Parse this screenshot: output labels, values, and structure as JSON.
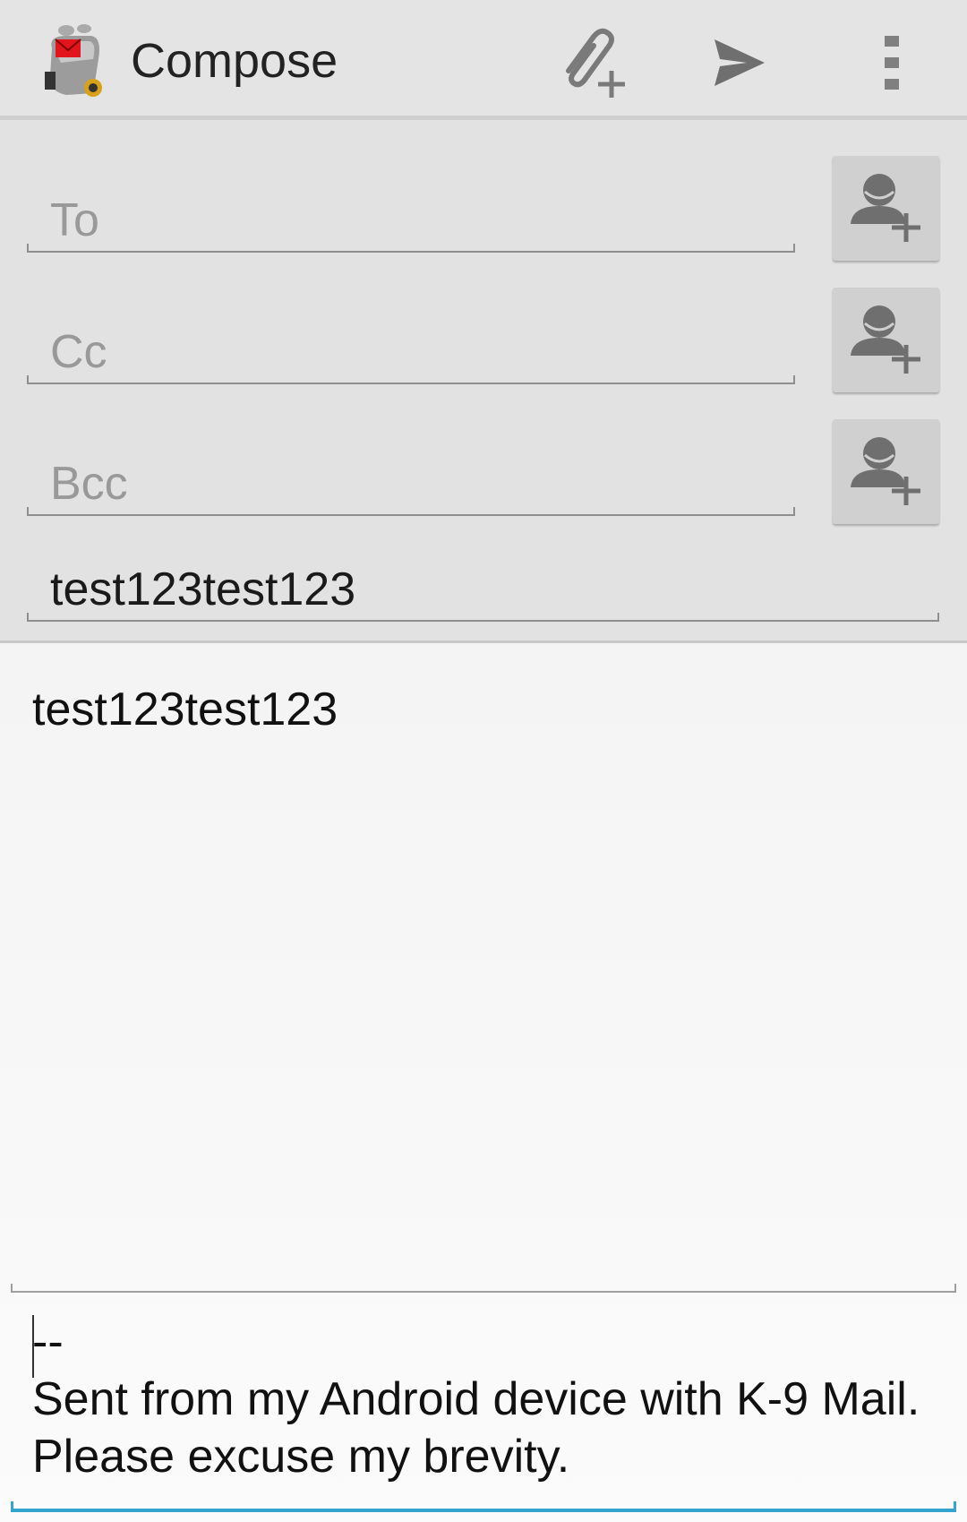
{
  "action_bar": {
    "title": "Compose",
    "icons": [
      "k9-app-icon",
      "attach-icon",
      "send-icon",
      "overflow-menu-icon"
    ]
  },
  "fields": {
    "to_placeholder": "To",
    "cc_placeholder": "Cc",
    "bcc_placeholder": "Bcc",
    "subject_value": "test123test123"
  },
  "body": {
    "message": "test123test123",
    "signature_separator": "--",
    "signature_text": "Sent from my Android device with K-9 Mail. Please excuse my brevity."
  },
  "colors": {
    "accent": "#33a3cf",
    "header_bg": "#e2e2e2",
    "action_bar_bg": "#e4e4e4"
  }
}
